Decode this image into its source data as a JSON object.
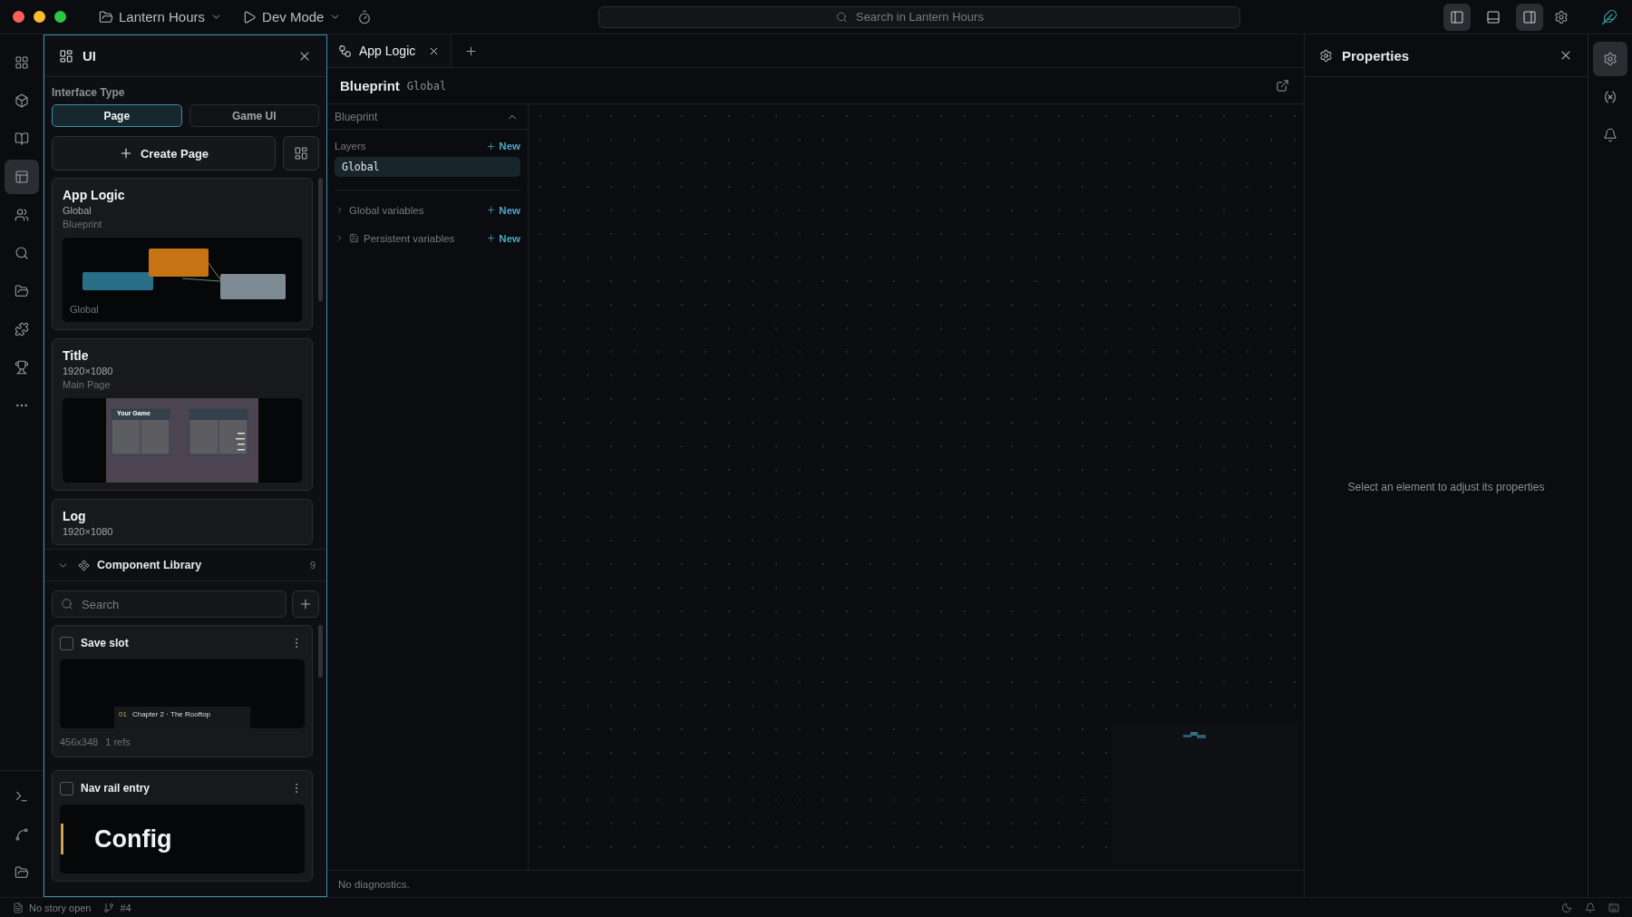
{
  "titlebar": {
    "project": "Lantern Hours",
    "mode": "Dev Mode",
    "search": {
      "placeholder": "Search in Lantern Hours"
    },
    "layout_toggles": [
      {
        "selected": true
      },
      {
        "selected": false
      },
      {
        "selected": true
      }
    ]
  },
  "nav_rail": {
    "items": [
      {
        "selected": false
      },
      {
        "selected": false
      },
      {
        "selected": false
      },
      {
        "selected": true
      },
      {
        "selected": false
      },
      {
        "selected": false
      },
      {
        "selected": false
      },
      {
        "selected": false
      },
      {
        "selected": false
      },
      {
        "selected": false
      }
    ],
    "bottom_items": [
      {
        "selected": false
      },
      {
        "selected": false
      },
      {
        "selected": false
      }
    ]
  },
  "ui_panel": {
    "title": "UI",
    "interface_type_label": "Interface Type",
    "interface_types": [
      {
        "label": "Page",
        "selected": true
      },
      {
        "label": "Game UI",
        "selected": false
      }
    ],
    "create_button": "Create Page",
    "pages": [
      {
        "title": "App Logic",
        "subtitle": "Global",
        "detail": "Blueprint",
        "preview": {
          "kind": "blueprint",
          "label": "Global"
        }
      },
      {
        "title": "Title",
        "subtitle": "1920×1080",
        "detail": "Main Page",
        "preview": {
          "kind": "title_screen",
          "heading": "Your Game"
        }
      },
      {
        "title": "Log",
        "subtitle": "1920×1080"
      }
    ]
  },
  "component_library": {
    "title": "Component Library",
    "count": "9",
    "expanded": true,
    "search": {
      "placeholder": "Search"
    },
    "components": [
      {
        "name": "Save slot",
        "checked": false,
        "preview": {
          "kind": "save_slot",
          "number": "01",
          "chapter": "Chapter 2 · The Rooftop"
        },
        "size": "456x348",
        "refs": "1 refs"
      },
      {
        "name": "Nav rail entry",
        "checked": false,
        "preview": {
          "kind": "nav_entry",
          "label": "Config"
        }
      }
    ]
  },
  "editor": {
    "tabs": [
      {
        "label": "App Logic",
        "selected": true
      }
    ],
    "header": {
      "title": "Blueprint",
      "scope": "Global"
    },
    "sidebar": {
      "section": "Blueprint",
      "expanded": true,
      "layers_label": "Layers",
      "layers_new": "New",
      "layers": [
        {
          "name": "Global",
          "selected": true
        }
      ],
      "groups": [
        {
          "label": "Global variables",
          "new": "New",
          "kind": "plain"
        },
        {
          "label": "Persistent variables",
          "new": "New",
          "kind": "saved"
        }
      ]
    },
    "diagnostics": "No diagnostics."
  },
  "properties": {
    "title": "Properties",
    "empty": "Select an element to adjust its properties"
  },
  "right_rail": {
    "items": [
      {
        "selected": true
      },
      {
        "selected": false
      },
      {
        "selected": false
      }
    ]
  },
  "status_bar": {
    "story": "No story open",
    "branch": "#4"
  }
}
